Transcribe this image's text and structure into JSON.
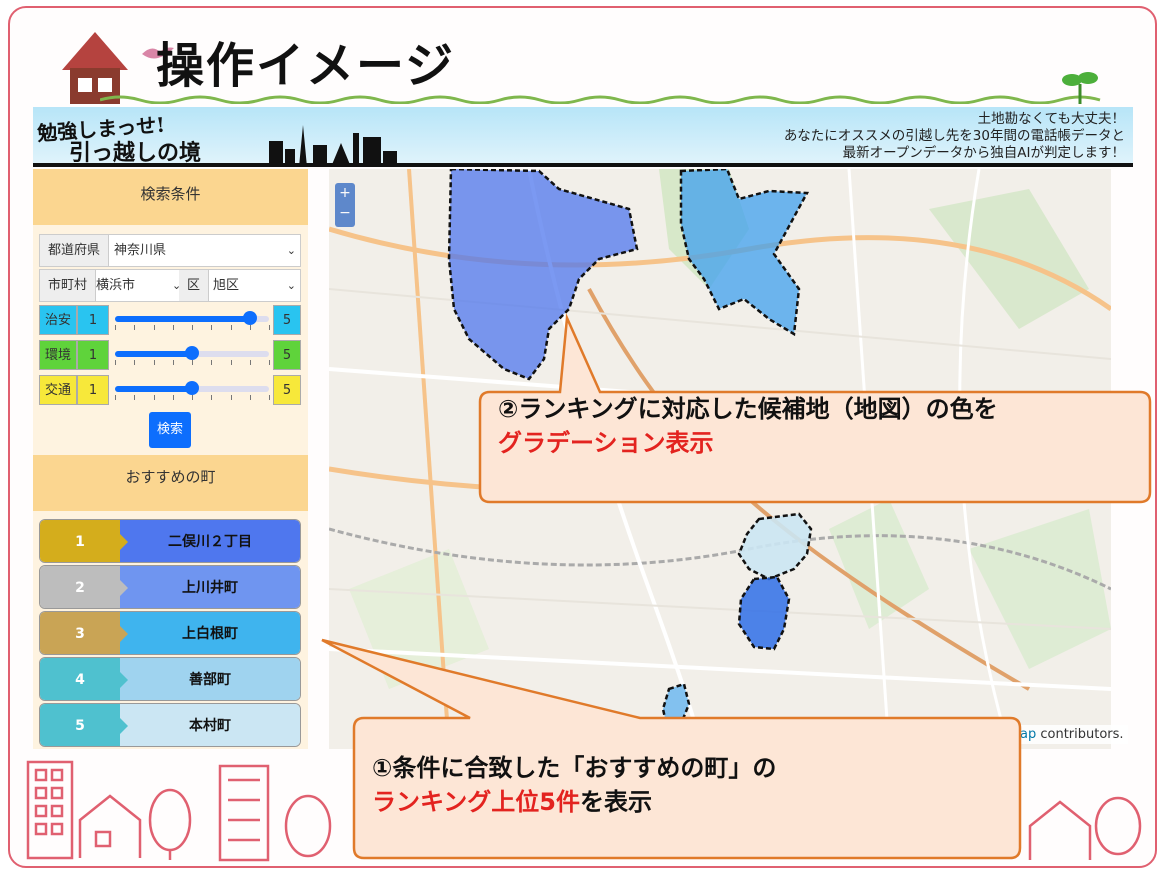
{
  "slide": {
    "title": "操作イメージ"
  },
  "banner": {
    "logo_line1": "勉強しまっせ!",
    "logo_line2": "引っ越しの境",
    "tagline": [
      "土地勘なくても大丈夫！",
      "あなたにオススメの引越し先を30年間の電話帳データと",
      "最新オープンデータから独自AIが判定します！"
    ]
  },
  "panel": {
    "conditions_header": "検索条件",
    "prefecture": {
      "label": "都道府県",
      "value": "神奈川県"
    },
    "city": {
      "label": "市町村",
      "value": "横浜市"
    },
    "ward": {
      "label": "区",
      "value": "旭区"
    },
    "sliders": [
      {
        "label": "治安",
        "min": "1",
        "max": "5",
        "value": 4.5,
        "color": "#29c4f0"
      },
      {
        "label": "環境",
        "min": "1",
        "max": "5",
        "value": 3,
        "color": "#5fd33b"
      },
      {
        "label": "交通",
        "min": "1",
        "max": "5",
        "value": 3,
        "color": "#f7e83a"
      }
    ],
    "search_button": "検索",
    "recommend_header": "おすすめの町",
    "ranking": [
      {
        "rank": "1",
        "name": "二俣川２丁目",
        "num_color": "#d4ad1c",
        "name_color": "#4f77ee"
      },
      {
        "rank": "2",
        "name": "上川井町",
        "num_color": "#bdbdbd",
        "name_color": "#6f95f0"
      },
      {
        "rank": "3",
        "name": "上白根町",
        "num_color": "#c9a455",
        "name_color": "#3fb4ee"
      },
      {
        "rank": "4",
        "name": "善部町",
        "num_color": "#4fc1cf",
        "name_color": "#9fd3ef"
      },
      {
        "rank": "5",
        "name": "本村町",
        "num_color": "#4fc1cf",
        "name_color": "#cbe6f3"
      }
    ]
  },
  "map": {
    "zoom_in": "+",
    "zoom_out": "−",
    "attribution_link": "ap",
    "attribution_text": " contributors."
  },
  "callouts": {
    "top_line1": "②ランキングに対応した候補地（地図）の色を",
    "top_line2": "グラデーション表示",
    "bottom_line1": "①条件に合致した「おすすめの町」の",
    "bottom_line2_highlight": "ランキング上位5件",
    "bottom_line2_rest": "を表示"
  }
}
